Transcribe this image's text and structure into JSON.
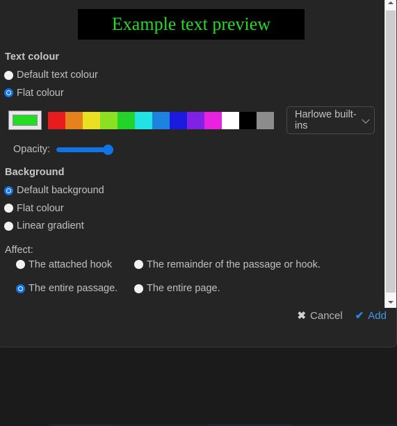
{
  "preview": {
    "text": "Example text preview",
    "text_color": "#22dd22",
    "background_color": "#000000"
  },
  "text_colour": {
    "heading": "Text colour",
    "options": [
      {
        "label": "Default text colour",
        "checked": false
      },
      {
        "label": "Flat colour",
        "checked": true
      }
    ],
    "current_swatch_color": "#22dd22",
    "palette": [
      "#e81c1c",
      "#e5821e",
      "#e8e021",
      "#8ce022",
      "#22d42a",
      "#22e3e3",
      "#1d82e0",
      "#1b1be0",
      "#8022e5",
      "#e822e0",
      "#ffffff",
      "#000000",
      "#8c8c8c"
    ],
    "builtins_label": "Harlowe built-ins",
    "builtins_icon": "chevron-down-icon",
    "opacity_label": "Opacity:",
    "opacity_value": 100
  },
  "background": {
    "heading": "Background",
    "options": [
      {
        "label": "Default background",
        "checked": true
      },
      {
        "label": "Flat colour",
        "checked": false
      },
      {
        "label": "Linear gradient",
        "checked": false
      }
    ]
  },
  "affect": {
    "label": "Affect:",
    "options": [
      {
        "label": "The attached hook",
        "checked": false
      },
      {
        "label": "The remainder of the passage or hook.",
        "checked": false
      },
      {
        "label": "The entire passage.",
        "checked": true
      },
      {
        "label": "The entire page.",
        "checked": false
      }
    ]
  },
  "footer": {
    "cancel_label": "Cancel",
    "cancel_icon": "✖",
    "add_label": "Add",
    "add_icon": "✔",
    "accent_color": "#3d9ae8"
  },
  "scrollbar": {
    "up_icon": "scroll-up-arrow",
    "down_icon": "scroll-down-arrow",
    "thumb_position": "top"
  }
}
